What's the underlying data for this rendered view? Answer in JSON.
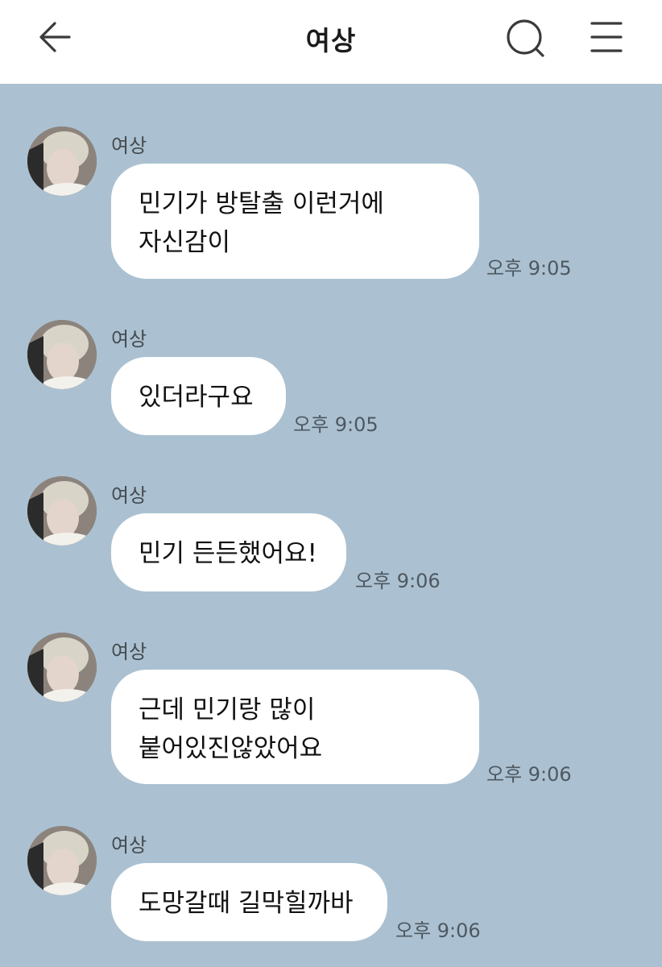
{
  "header": {
    "title": "여상"
  },
  "messages": [
    {
      "sender": "여상",
      "text": "민기가 방탈출 이런거에\n자신감이",
      "time": "오후 9:05"
    },
    {
      "sender": "여상",
      "text": "있더라구요",
      "time": "오후 9:05"
    },
    {
      "sender": "여상",
      "text": "민기 든든했어요!",
      "time": "오후 9:06"
    },
    {
      "sender": "여상",
      "text": "근데 민기랑 많이\n붙어있진않았어요",
      "time": "오후 9:06"
    },
    {
      "sender": "여상",
      "text": "도망갈때 길막힐까바",
      "time": "오후 9:06"
    }
  ]
}
